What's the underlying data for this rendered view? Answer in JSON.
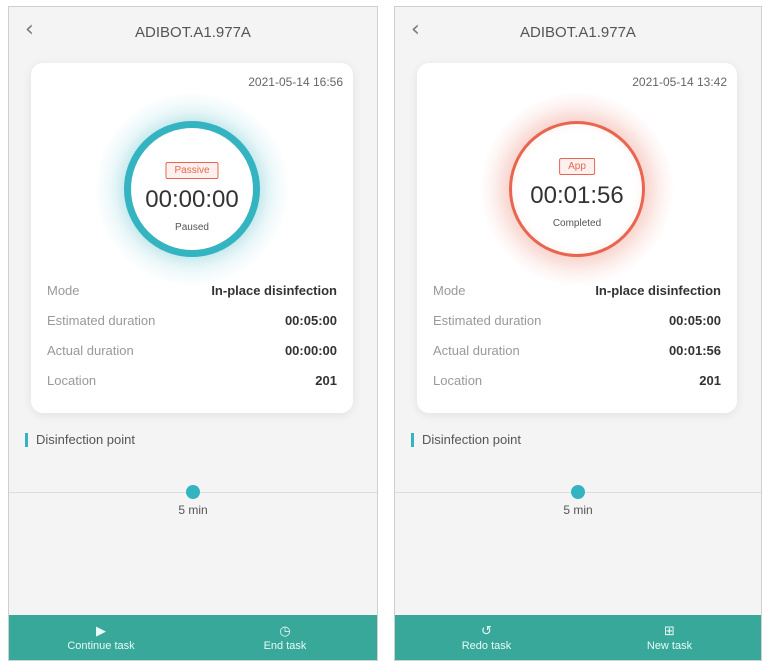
{
  "screens": [
    {
      "title": "ADIBOT.A1.977A",
      "timestamp": "2021-05-14 16:56",
      "badge": "Passive",
      "timer": "00:00:00",
      "state": "Paused",
      "ring_color": "#34b3c1",
      "details": [
        {
          "label": "Mode",
          "value": "In-place disinfection"
        },
        {
          "label": "Estimated duration",
          "value": "00:05:00"
        },
        {
          "label": "Actual duration",
          "value": "00:00:00"
        },
        {
          "label": "Location",
          "value": "201"
        }
      ],
      "section_label": "Disinfection point",
      "point_label": "5 min",
      "actions": [
        {
          "label": "Continue task",
          "icon": "play-icon"
        },
        {
          "label": "End task",
          "icon": "clock-icon"
        }
      ]
    },
    {
      "title": "ADIBOT.A1.977A",
      "timestamp": "2021-05-14 13:42",
      "badge": "App",
      "timer": "00:01:56",
      "state": "Completed",
      "ring_color": "#e8664f",
      "details": [
        {
          "label": "Mode",
          "value": "In-place disinfection"
        },
        {
          "label": "Estimated duration",
          "value": "00:05:00"
        },
        {
          "label": "Actual duration",
          "value": "00:01:56"
        },
        {
          "label": "Location",
          "value": "201"
        }
      ],
      "section_label": "Disinfection point",
      "point_label": "5 min",
      "actions": [
        {
          "label": "Redo task",
          "icon": "redo-icon"
        },
        {
          "label": "New task",
          "icon": "new-task-icon"
        }
      ]
    }
  ],
  "accent_color": "#37a89a"
}
